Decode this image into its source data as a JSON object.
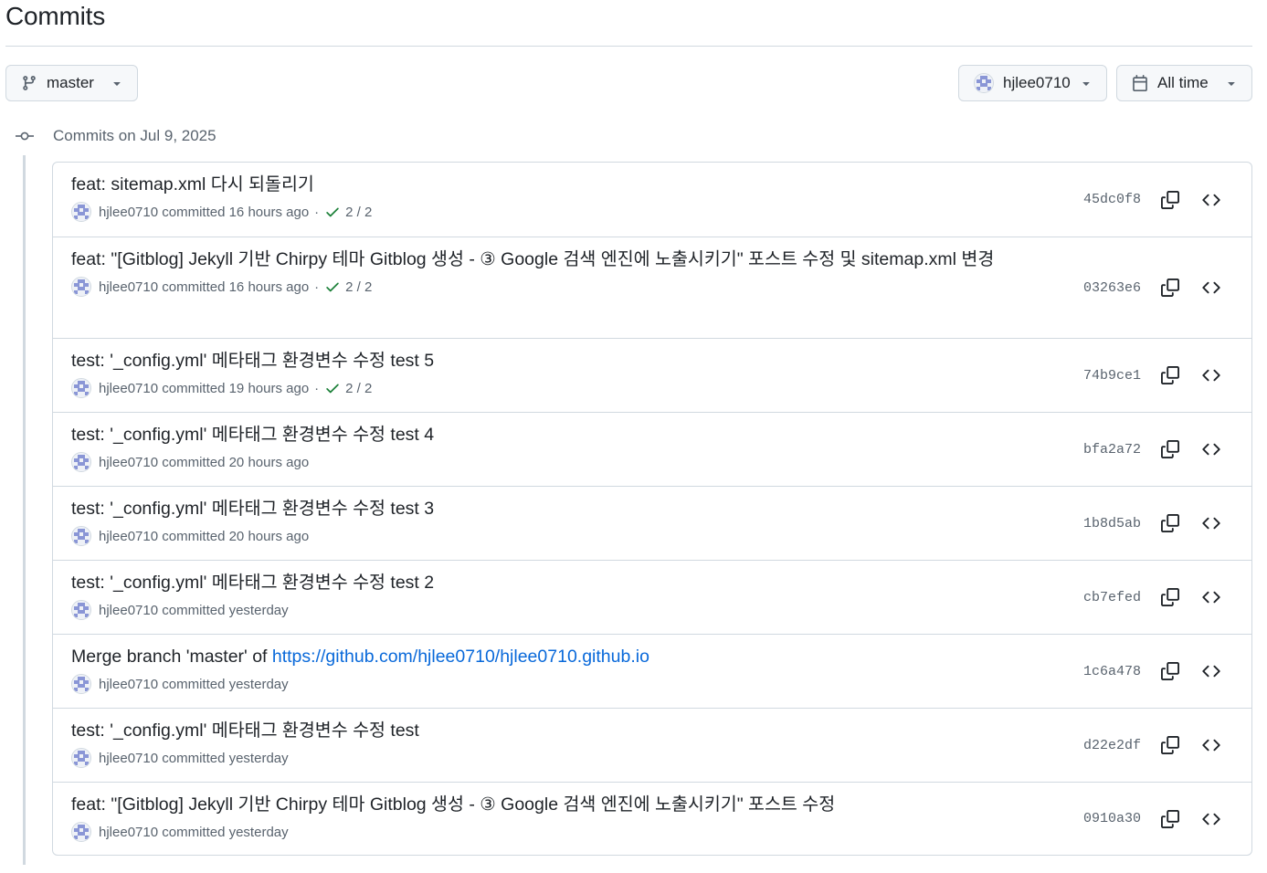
{
  "page": {
    "title": "Commits"
  },
  "filters": {
    "branch": "master",
    "author": "hjlee0710",
    "time": "All time"
  },
  "group": {
    "label": "Commits on Jul 9, 2025"
  },
  "commits": [
    {
      "message": "feat: sitemap.xml 다시 되돌리기",
      "author": "hjlee0710",
      "action": "committed",
      "time": "16 hours ago",
      "checks": "2 / 2",
      "sha": "45dc0f8"
    },
    {
      "message": "feat: \"[Gitblog] Jekyll 기반 Chirpy 테마 Gitblog 생성 - ③ Google 검색 엔진에 노출시키기\" 포스트 수정 및 sitemap.xml 변경",
      "author": "hjlee0710",
      "action": "committed",
      "time": "16 hours ago",
      "checks": "2 / 2",
      "sha": "03263e6"
    },
    {
      "message": "test: '_config.yml' 메타태그 환경변수 수정 test 5",
      "author": "hjlee0710",
      "action": "committed",
      "time": "19 hours ago",
      "checks": "2 / 2",
      "sha": "74b9ce1"
    },
    {
      "message": "test: '_config.yml' 메타태그 환경변수 수정 test 4",
      "author": "hjlee0710",
      "action": "committed",
      "time": "20 hours ago",
      "checks": "",
      "sha": "bfa2a72"
    },
    {
      "message": "test: '_config.yml' 메타태그 환경변수 수정 test 3",
      "author": "hjlee0710",
      "action": "committed",
      "time": "20 hours ago",
      "checks": "",
      "sha": "1b8d5ab"
    },
    {
      "message": "test: '_config.yml' 메타태그 환경변수 수정 test 2",
      "author": "hjlee0710",
      "action": "committed",
      "time": "yesterday",
      "checks": "",
      "sha": "cb7efed"
    },
    {
      "message": "Merge branch 'master' of ",
      "link": "https://github.com/hjlee0710/hjlee0710.github.io",
      "author": "hjlee0710",
      "action": "committed",
      "time": "yesterday",
      "checks": "",
      "sha": "1c6a478"
    },
    {
      "message": "test: '_config.yml' 메타태그 환경변수 수정 test",
      "author": "hjlee0710",
      "action": "committed",
      "time": "yesterday",
      "checks": "",
      "sha": "d22e2df"
    },
    {
      "message": "feat: \"[Gitblog] Jekyll 기반 Chirpy 테마 Gitblog 생성 - ③ Google 검색 엔진에 노출시키기\" 포스트 수정",
      "author": "hjlee0710",
      "action": "committed",
      "time": "yesterday",
      "checks": "",
      "sha": "0910a30"
    }
  ],
  "icons": {
    "branch": "git-branch-icon",
    "caret": "triangle-down-icon",
    "calendar": "calendar-icon",
    "commit": "git-commit-icon",
    "check": "check-icon",
    "copy": "copy-icon",
    "browse": "code-icon"
  },
  "colors": {
    "border": "#d1d9e0",
    "muted": "#59636e",
    "link": "#0969da",
    "success": "#1a7f37",
    "button_bg": "#f6f8fa"
  }
}
